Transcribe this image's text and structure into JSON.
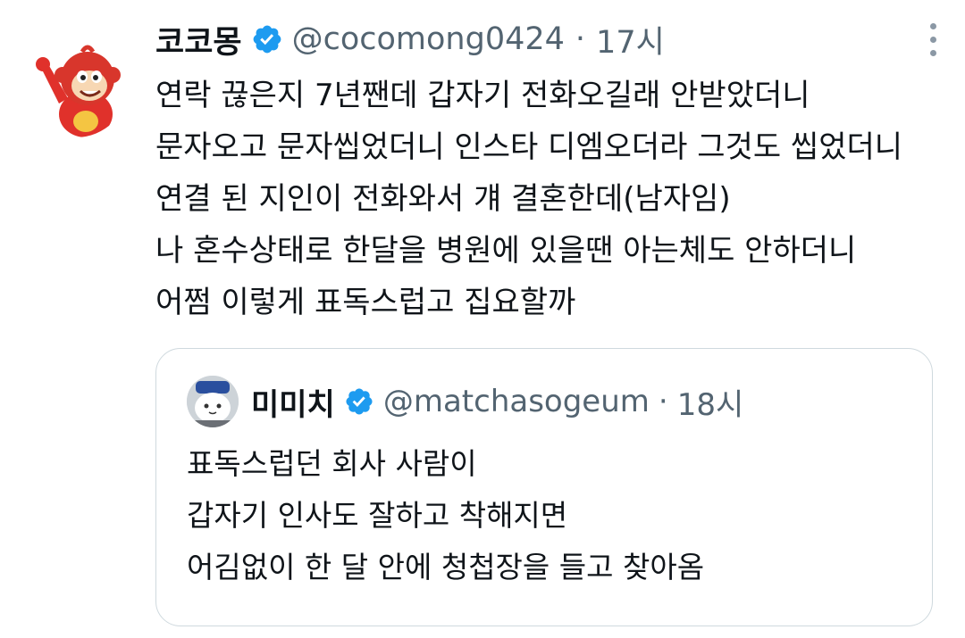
{
  "tweet": {
    "display_name": "코코몽",
    "handle": "@cocomong0424",
    "separator": "·",
    "time": "17시",
    "lines": [
      "연락 끊은지 7년짼데 갑자기 전화오길래 안받았더니",
      "문자오고 문자씹었더니 인스타 디엠오더라 그것도 씹었더니",
      "연결 된 지인이 전화와서 걔 결혼한데(남자임)",
      "나 혼수상태로 한달을 병원에 있을땐 아는체도 안하더니",
      "어쩜 이렇게 표독스럽고 집요할까"
    ],
    "avatar_icon": "cocomong-monkey-avatar",
    "verified_icon": "verified-badge-icon",
    "more_icon": "more-vertical-icon"
  },
  "quote": {
    "display_name": "미미치",
    "handle": "@matchasogeum",
    "separator": "·",
    "time": "18시",
    "lines": [
      "표독스럽던 회사 사람이",
      "갑자기 인사도 잘하고 착해지면",
      "어김없이 한 달 안에 청첩장을 들고 찾아옴"
    ],
    "avatar_icon": "character-avatar"
  },
  "colors": {
    "verified": "#1d9bf0",
    "secondary_text": "#536471",
    "border": "#cfd9de"
  }
}
